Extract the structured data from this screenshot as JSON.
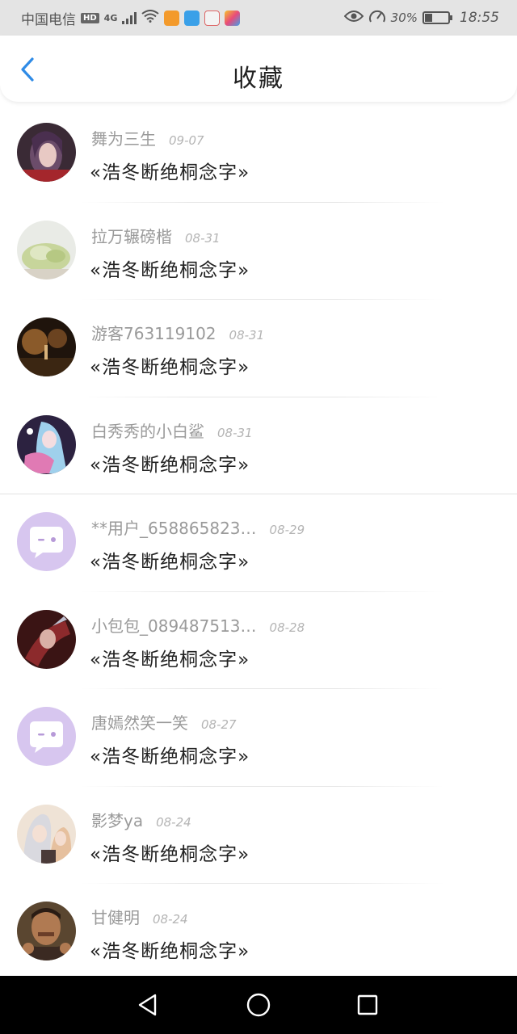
{
  "status_bar": {
    "carrier": "中国电信",
    "hd_badge": "HD",
    "network": "4G",
    "battery_percent": "30%",
    "time": "18:55"
  },
  "header": {
    "title": "收藏"
  },
  "favorites": [
    {
      "name": "舞为三生",
      "date": "09-07",
      "work": "«浩冬断绝桐念字»",
      "avatar": "anime-girl-purple"
    },
    {
      "name": "拉万辗磅楷",
      "date": "08-31",
      "work": "«浩冬断绝桐念字»",
      "avatar": "flowers-white"
    },
    {
      "name": "游客763119102",
      "date": "08-31",
      "work": "«浩冬断绝桐念字»",
      "avatar": "night-street"
    },
    {
      "name": "白秀秀的小白鲨",
      "date": "08-31",
      "work": "«浩冬断绝桐念字»",
      "avatar": "anime-girl-blue"
    },
    {
      "name": "**用户_658865823…",
      "date": "08-29",
      "work": "«浩冬断绝桐念字»",
      "avatar": "default-chat-purple"
    },
    {
      "name": "小包包_089487513…",
      "date": "08-28",
      "work": "«浩冬断绝桐念字»",
      "avatar": "fantasy-red"
    },
    {
      "name": "唐嫣然笑一笑",
      "date": "08-27",
      "work": "«浩冬断绝桐念字»",
      "avatar": "default-chat-purple"
    },
    {
      "name": "影梦ya",
      "date": "08-24",
      "work": "«浩冬断绝桐念字»",
      "avatar": "anime-pair"
    },
    {
      "name": "甘健明",
      "date": "08-24",
      "work": "«浩冬断绝桐念字»",
      "avatar": "man-photo"
    }
  ],
  "colors": {
    "accent_blue": "#2f8be6",
    "default_avatar": "#d7c6ef"
  }
}
